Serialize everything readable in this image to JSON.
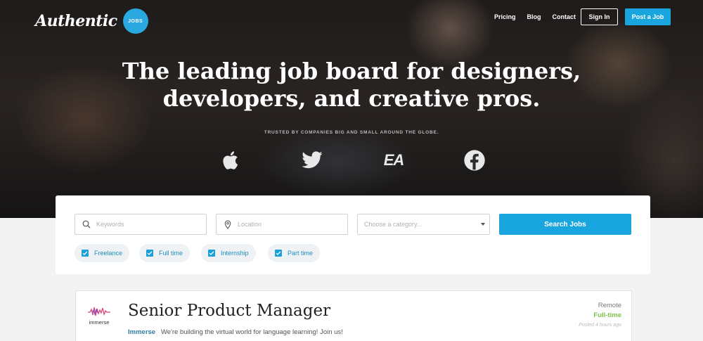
{
  "brand": {
    "logo_text": "Authentic",
    "badge": "JOBS"
  },
  "nav": {
    "links": [
      "Pricing",
      "Blog",
      "Contact"
    ],
    "sign_in": "Sign In",
    "post_job": "Post a Job"
  },
  "hero": {
    "headline_line1": "The leading job board for designers,",
    "headline_line2": "developers, and creative pros.",
    "trusted": "TRUSTED BY COMPANIES BIG AND SMALL AROUND THE GLOBE.",
    "brands": [
      "apple-icon",
      "twitter-icon",
      "ea-icon",
      "facebook-icon"
    ],
    "ea_text": "EA"
  },
  "search": {
    "keywords_placeholder": "Keywords",
    "location_placeholder": "Location",
    "category_placeholder": "Choose a category...",
    "button": "Search Jobs",
    "filters": [
      {
        "label": "Freelance",
        "checked": true
      },
      {
        "label": "Full time",
        "checked": true
      },
      {
        "label": "Internship",
        "checked": true
      },
      {
        "label": "Part time",
        "checked": true
      }
    ]
  },
  "jobs": [
    {
      "title": "Senior Product Manager",
      "company": "Immerse",
      "logo_text": "immerse",
      "description": "We're building the virtual world for language learning! Join us!",
      "location": "Remote",
      "type": "Full-time",
      "posted": "Posted 4 hours ago"
    }
  ],
  "colors": {
    "accent": "#19a6de",
    "fulltime": "#7cc245"
  }
}
